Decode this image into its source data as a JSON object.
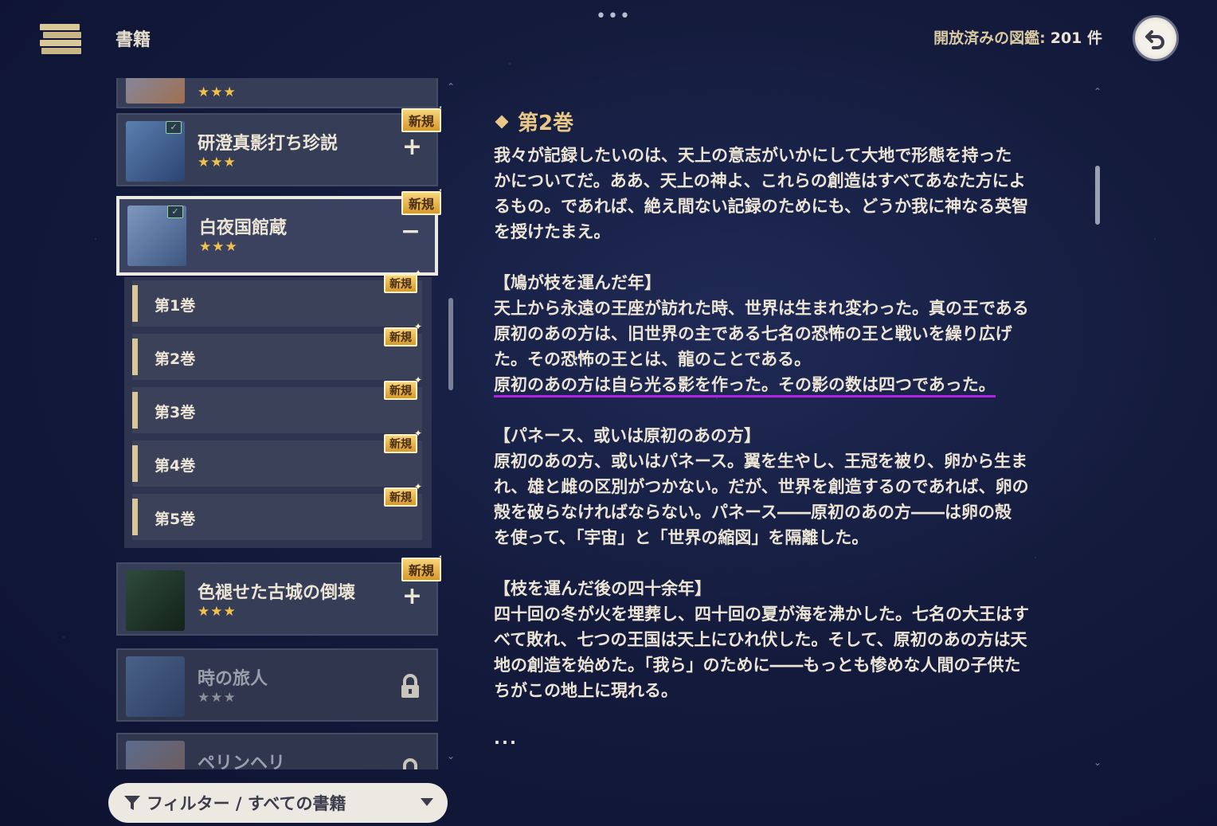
{
  "header": {
    "title": "書籍",
    "open_count_label": "開放済みの図鑑:",
    "open_count_value": "201 件"
  },
  "books": [
    {
      "title": "研澄真影打ち珍説",
      "stars": "★★★",
      "badge": "新規",
      "action": "+"
    },
    {
      "title": "白夜国館蔵",
      "stars": "★★★",
      "badge": "新規",
      "action": "−"
    },
    {
      "title": "色褪せた古城の倒壊",
      "stars": "★★★",
      "badge": "新規",
      "action": "+"
    },
    {
      "title": "時の旅人",
      "stars": "★★★"
    },
    {
      "title": "ペリンヘリ"
    }
  ],
  "chapters": [
    {
      "label": "第1巻",
      "badge": "新規"
    },
    {
      "label": "第2巻",
      "badge": "新規"
    },
    {
      "label": "第3巻",
      "badge": "新規"
    },
    {
      "label": "第4巻",
      "badge": "新規"
    },
    {
      "label": "第5巻",
      "badge": "新規"
    }
  ],
  "filter": {
    "label": "フィルター / すべての書籍"
  },
  "content": {
    "chapter_title": "第2巻",
    "intro": "我々が記録したいのは、天上の意志がいかにして大地で形態を持った\nかについてだ。ああ、天上の神よ、これらの創造はすべてあなた方によ\nるもの。であれば、絶え間ない記録のためにも、どうか我に神なる英智\nを授けたまえ。",
    "section1_title": "【鳩が枝を運んだ年】",
    "section1_body": "天上から永遠の王座が訪れた時、世界は生まれ変わった。真の王である\n原初のあの方は、旧世界の主である七名の恐怖の王と戦いを繰り広げ\nた。その恐怖の王とは、龍のことである。",
    "section1_highlight": "原初のあの方は自ら光る影を作った。その影の数は四つであった。",
    "section2_title": "【パネース、或いは原初のあの方】",
    "section2_body": "原初のあの方、或いはパネース。翼を生やし、王冠を被り、卵から生ま\nれ、雄と雌の区別がつかない。だが、世界を創造するのであれば、卵の\n殻を破らなければならない。パネース――原初のあの方――は卵の殻\nを使って、「宇宙」と「世界の縮図」を隔離した。",
    "section3_title": "【枝を運んだ後の四十余年】",
    "section3_body": "四十回の冬が火を埋葬し、四十回の夏が海を沸かした。七名の大王はす\nべて敗れ、七つの王国は天上にひれ伏した。そして、原初のあの方は天\n地の創造を始めた。「我ら」のために――もっとも惨めな人間の子供た\nちがこの地上に現れる。",
    "ellipsis": "..."
  }
}
